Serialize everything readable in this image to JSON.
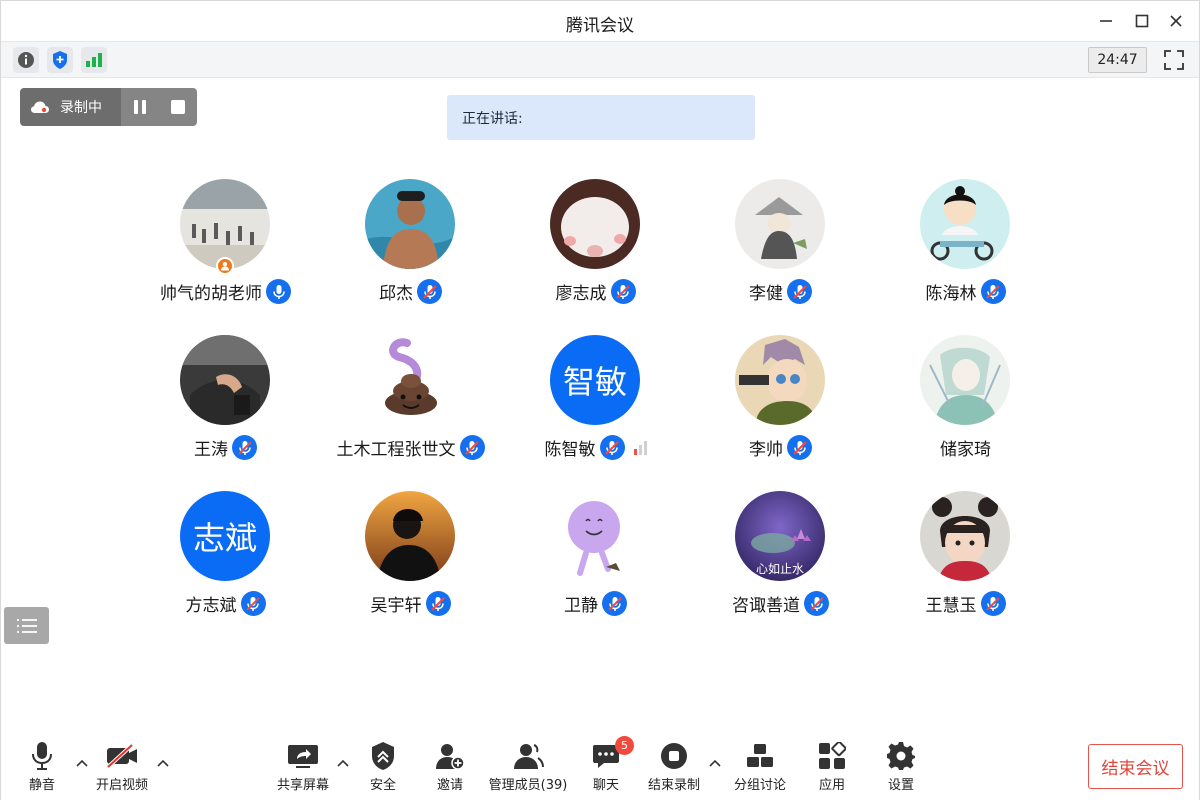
{
  "window": {
    "title": "腾讯会议"
  },
  "infobar": {
    "timer": "24:47"
  },
  "recording": {
    "label": "录制中"
  },
  "speaking": {
    "label": "正在讲话:"
  },
  "participants": [
    {
      "name": "帅气的胡老师",
      "avatar": "photo-crowd",
      "host": true,
      "mic": "on"
    },
    {
      "name": "邱杰",
      "avatar": "photo-swimmer",
      "mic": "muted"
    },
    {
      "name": "廖志成",
      "avatar": "photo-hamster",
      "mic": "muted"
    },
    {
      "name": "李健",
      "avatar": "photo-monk-drawing",
      "mic": "muted"
    },
    {
      "name": "陈海林",
      "avatar": "photo-cartoon-scooter",
      "mic": "muted"
    },
    {
      "name": "王涛",
      "avatar": "photo-car-interior",
      "mic": "muted"
    },
    {
      "name": "土木工程张世文",
      "avatar": "photo-poop-emoji",
      "mic": "muted"
    },
    {
      "name": "陈智敏",
      "avatar_text": "智敏",
      "mic": "muted",
      "signal": true
    },
    {
      "name": "李帅",
      "avatar": "photo-anime-boy",
      "mic": "muted"
    },
    {
      "name": "储家琦",
      "avatar": "photo-anime-sketch",
      "mic": "none"
    },
    {
      "name": "方志斌",
      "avatar_text": "志斌",
      "mic": "muted"
    },
    {
      "name": "吴宇轩",
      "avatar": "photo-sunset-person",
      "mic": "muted"
    },
    {
      "name": "卫静",
      "avatar": "photo-purple-blob",
      "mic": "muted"
    },
    {
      "name": "咨诹善道",
      "avatar": "photo-lotus",
      "avatar_caption": "心如止水",
      "mic": "muted"
    },
    {
      "name": "王慧玉",
      "avatar": "photo-little-girl",
      "mic": "muted"
    }
  ],
  "toolbar": {
    "mute": "静音",
    "video": "开启视频",
    "share": "共享屏幕",
    "security": "安全",
    "invite": "邀请",
    "members": "管理成员(39)",
    "chat": "聊天",
    "chat_badge": "5",
    "end_record": "结束录制",
    "breakout": "分组讨论",
    "apps": "应用",
    "settings": "设置",
    "end_meeting": "结束会议"
  },
  "colors": {
    "accent": "#1570f0",
    "danger": "#e0443a",
    "host": "#f07a1a"
  }
}
